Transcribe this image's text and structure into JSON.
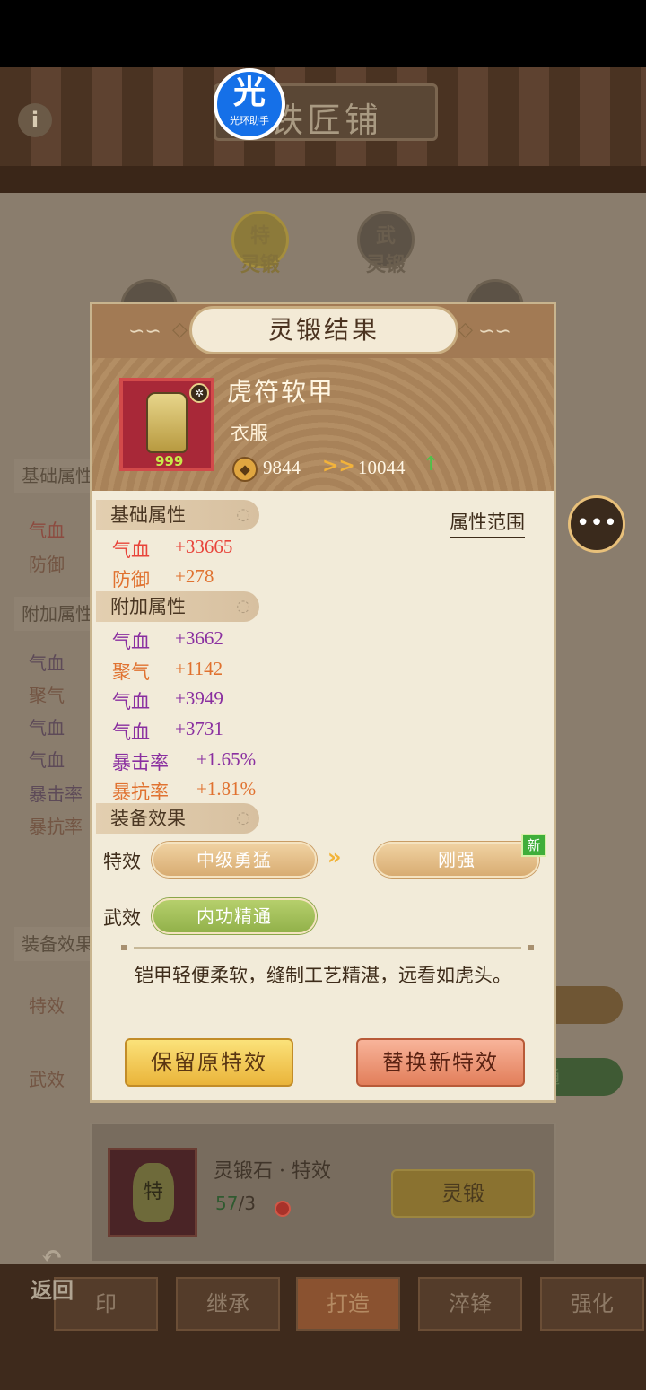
{
  "background": {
    "sign_text": "铁匠铺",
    "info_icon": "i",
    "nodes": [
      {
        "line1": "特",
        "line2": "灵锻",
        "active": true
      },
      {
        "line1": "武",
        "line2": "灵锻",
        "active": false
      }
    ],
    "left_sections": [
      "基础属性",
      "附加属性",
      "装备效果"
    ],
    "left_items": [
      "气血",
      "防御",
      "气血",
      "聚气",
      "气血",
      "气血",
      "暴击率",
      "暴抗率",
      "特效",
      "武效"
    ],
    "right_bar_text": "通",
    "stone": {
      "name": "灵锻石 · 特效",
      "have": "57",
      "need": "/3",
      "gem_char": "特",
      "forge_button": "灵锻"
    },
    "tabs": [
      {
        "label": "印",
        "active": false
      },
      {
        "label": "继承",
        "active": false
      },
      {
        "label": "打造",
        "active": true
      },
      {
        "label": "淬锋",
        "active": false
      },
      {
        "label": "强化",
        "active": false
      }
    ],
    "back_label": "返回"
  },
  "watermark": {
    "big": "光",
    "small": "光环助手"
  },
  "chat_icon": "chat-bubble-icon",
  "modal": {
    "title": "灵锻结果",
    "equipment": {
      "name": "虎符软甲",
      "type": "衣服",
      "level_badge": "999",
      "power_old": "9844",
      "power_new": "10044",
      "power_arrow": ">>",
      "power_up_arrow": "↑"
    },
    "attr_range_link": "属性范围",
    "base_section": "基础属性",
    "base_attrs": [
      {
        "name": "气血",
        "value": "+33665",
        "color": "#e8443a"
      },
      {
        "name": "防御",
        "value": "+278",
        "color": "#e07230"
      }
    ],
    "extra_section": "附加属性",
    "extra_attrs": [
      {
        "name": "气血",
        "value": "+3662",
        "color": "#8a2fa0"
      },
      {
        "name": "聚气",
        "value": "+1142",
        "color": "#e07230"
      },
      {
        "name": "气血",
        "value": "+3949",
        "color": "#8a2fa0"
      },
      {
        "name": "气血",
        "value": "+3731",
        "color": "#8a2fa0"
      },
      {
        "name": "暴击率",
        "value": "+1.65%",
        "color": "#8a2fa0"
      },
      {
        "name": "暴抗率",
        "value": "+1.81%",
        "color": "#e07230"
      }
    ],
    "effect_section": "装备效果",
    "special_label": "特效",
    "special_old": "中级勇猛",
    "special_new": "刚强",
    "new_badge": "新",
    "wu_label": "武效",
    "wu_value": "内功精通",
    "description": "铠甲轻便柔软，缝制工艺精湛，远看如虎头。",
    "keep_button": "保留原特效",
    "replace_button": "替换新特效"
  }
}
